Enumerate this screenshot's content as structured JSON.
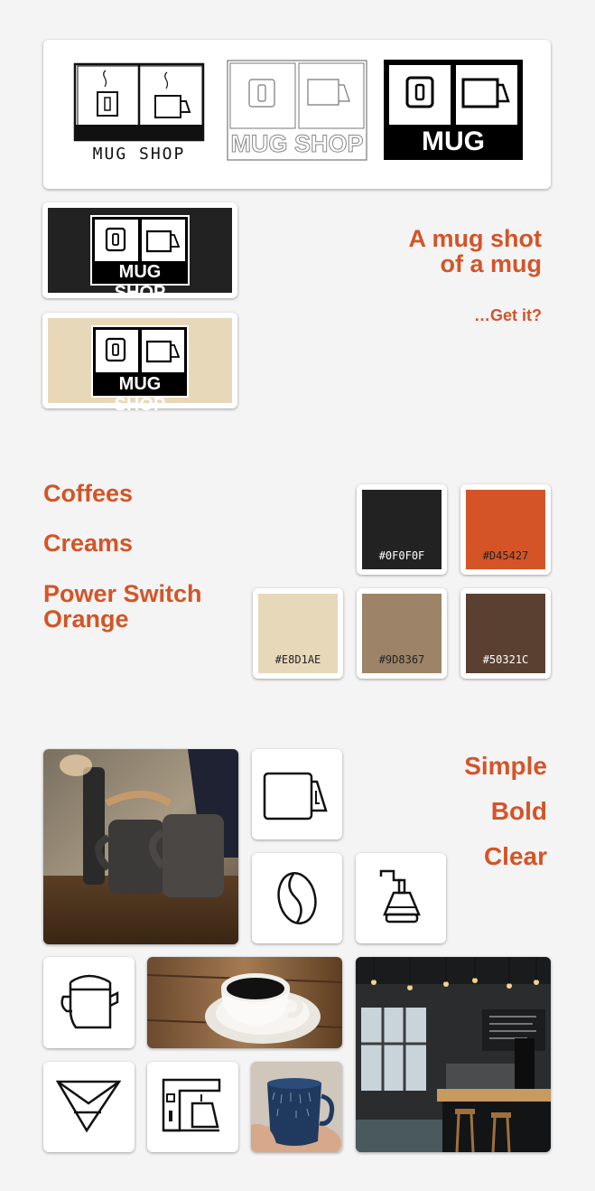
{
  "logos": {
    "sketch_text": "MUG SHOP",
    "outline_text": "MUG SHOP",
    "solid_text": "MUG SHOP",
    "dark_banner_text": "MUG SHOP",
    "cream_banner_text": "MUG SHOP"
  },
  "tagline": {
    "line1": "A mug shot",
    "line2": "of a mug",
    "joke": "…Get it?"
  },
  "palette": {
    "names": [
      "Coffees",
      "Creams",
      "Power Switch",
      "Orange"
    ],
    "swatches": [
      {
        "hex": "#0F0F0F",
        "label": "#0F0F0F"
      },
      {
        "hex": "#D45427",
        "label": "#D45427"
      },
      {
        "hex": "#E8D1AE",
        "label": "#E8D1AE"
      },
      {
        "hex": "#9D8367",
        "label": "#9D8367"
      },
      {
        "hex": "#50321C",
        "label": "#50321C"
      }
    ]
  },
  "principles": [
    "Simple",
    "Bold",
    "Clear"
  ],
  "icons": [
    "mug-icon",
    "coffee-bean-icon",
    "coffee-grinder-icon",
    "kettle-icon",
    "pour-over-icon",
    "coffee-machine-icon"
  ],
  "colors": {
    "accent": "#D45427",
    "dark": "#222222",
    "cream": "#E8D8BA",
    "background": "#F4F4F4"
  }
}
